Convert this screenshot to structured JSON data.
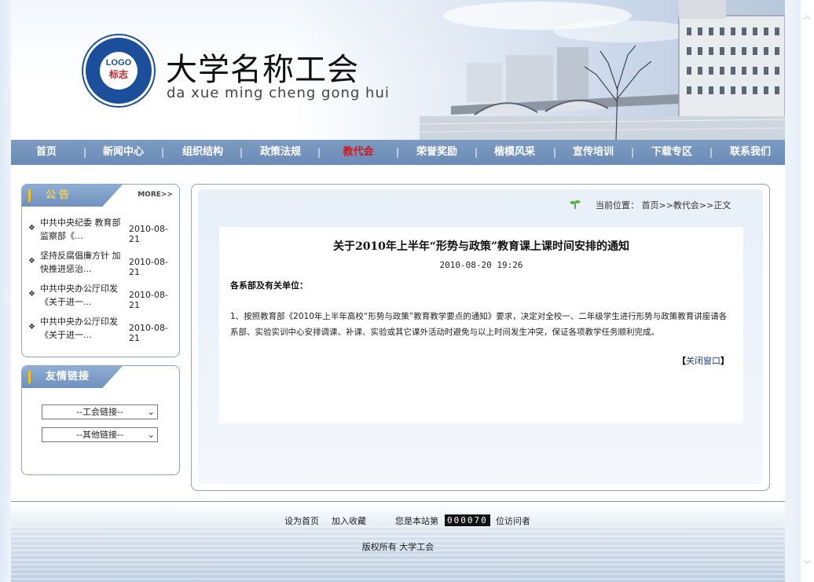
{
  "header": {
    "logo_text": "LOGO",
    "logo_sub": "标志",
    "title": "大学名称工会",
    "subtitle": "da xue ming cheng gong hui"
  },
  "nav": {
    "items": [
      {
        "label": "首页"
      },
      {
        "label": "新闻中心"
      },
      {
        "label": "组织结构"
      },
      {
        "label": "政策法规"
      },
      {
        "label": "教代会",
        "active": true
      },
      {
        "label": "荣誉奖励"
      },
      {
        "label": "楷模风采"
      },
      {
        "label": "宣传培训"
      },
      {
        "label": "下载专区"
      },
      {
        "label": "联系我们"
      }
    ],
    "separator": "|"
  },
  "notice": {
    "title": "公告",
    "more": "MORE>>",
    "items": [
      {
        "title": "中共中央纪委 教育部 监察部《...",
        "date": "2010-08-21"
      },
      {
        "title": "坚持反腐倡廉方针 加快推进惩治...",
        "date": "2010-08-21"
      },
      {
        "title": "中共中央办公厅印发《关于进一...",
        "date": "2010-08-21"
      },
      {
        "title": "中共中央办公厅印发《关于进一...",
        "date": "2010-08-21"
      }
    ]
  },
  "links": {
    "title": "友情链接",
    "select1": "--工会链接--",
    "select2": "--其他链接--"
  },
  "breadcrumb": {
    "label": "当前位置：",
    "path": "首页>>教代会>>正文"
  },
  "article": {
    "title": "关于2010年上半年“形势与政策”教育课上课时间安排的通知",
    "date": "2010-08-20 19:26",
    "greeting": "各系部及有关单位：",
    "body": "1、按照教育部《2010年上半年高校“形势与政策”教育教学要点的通知》要求，决定对全校一、二年级学生进行形势与政策教育讲座请各系部、实验实训中心安排调课、补课、实验或其它课外活动时避免与以上时间发生冲突，保证各项教学任务顺利完成。",
    "close_open": "【",
    "close_label": "关闭窗口",
    "close_close": "】"
  },
  "footer": {
    "set_home": "设为首页",
    "add_fav": "加入收藏",
    "visitor_prefix": "您是本站第",
    "visitor_count": "000070",
    "visitor_suffix": "位访问者",
    "copyright": "版权所有  大学工会"
  }
}
